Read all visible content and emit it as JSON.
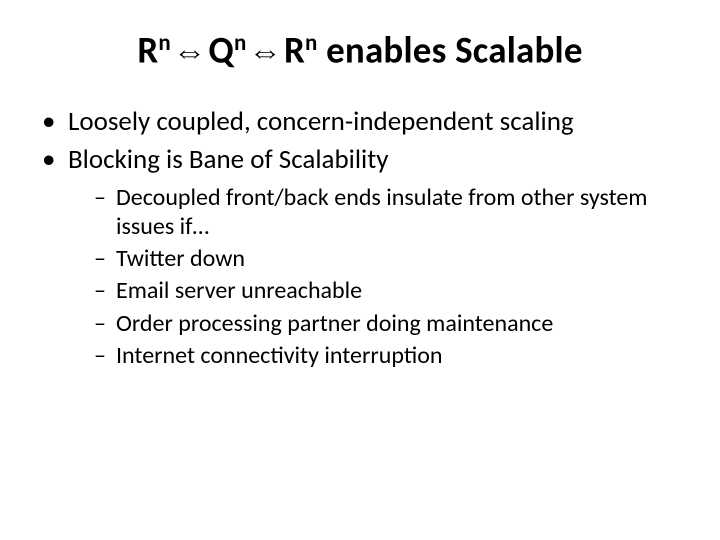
{
  "title": {
    "seg1": "R",
    "sup1": "n",
    "seg2": "Q",
    "sup2": "n",
    "seg3": "R",
    "sup3": "n",
    "rest": " enables Scalable"
  },
  "bullets": [
    "Loosely coupled, concern-independent scaling",
    "Blocking is Bane of Scalability"
  ],
  "subbullets": [
    "Decoupled front/back ends insulate from other system issues if…",
    "Twitter down",
    "Email server unreachable",
    "Order processing partner doing maintenance",
    "Internet connectivity interruption"
  ],
  "icons": {
    "double_arrow": "⇔"
  }
}
